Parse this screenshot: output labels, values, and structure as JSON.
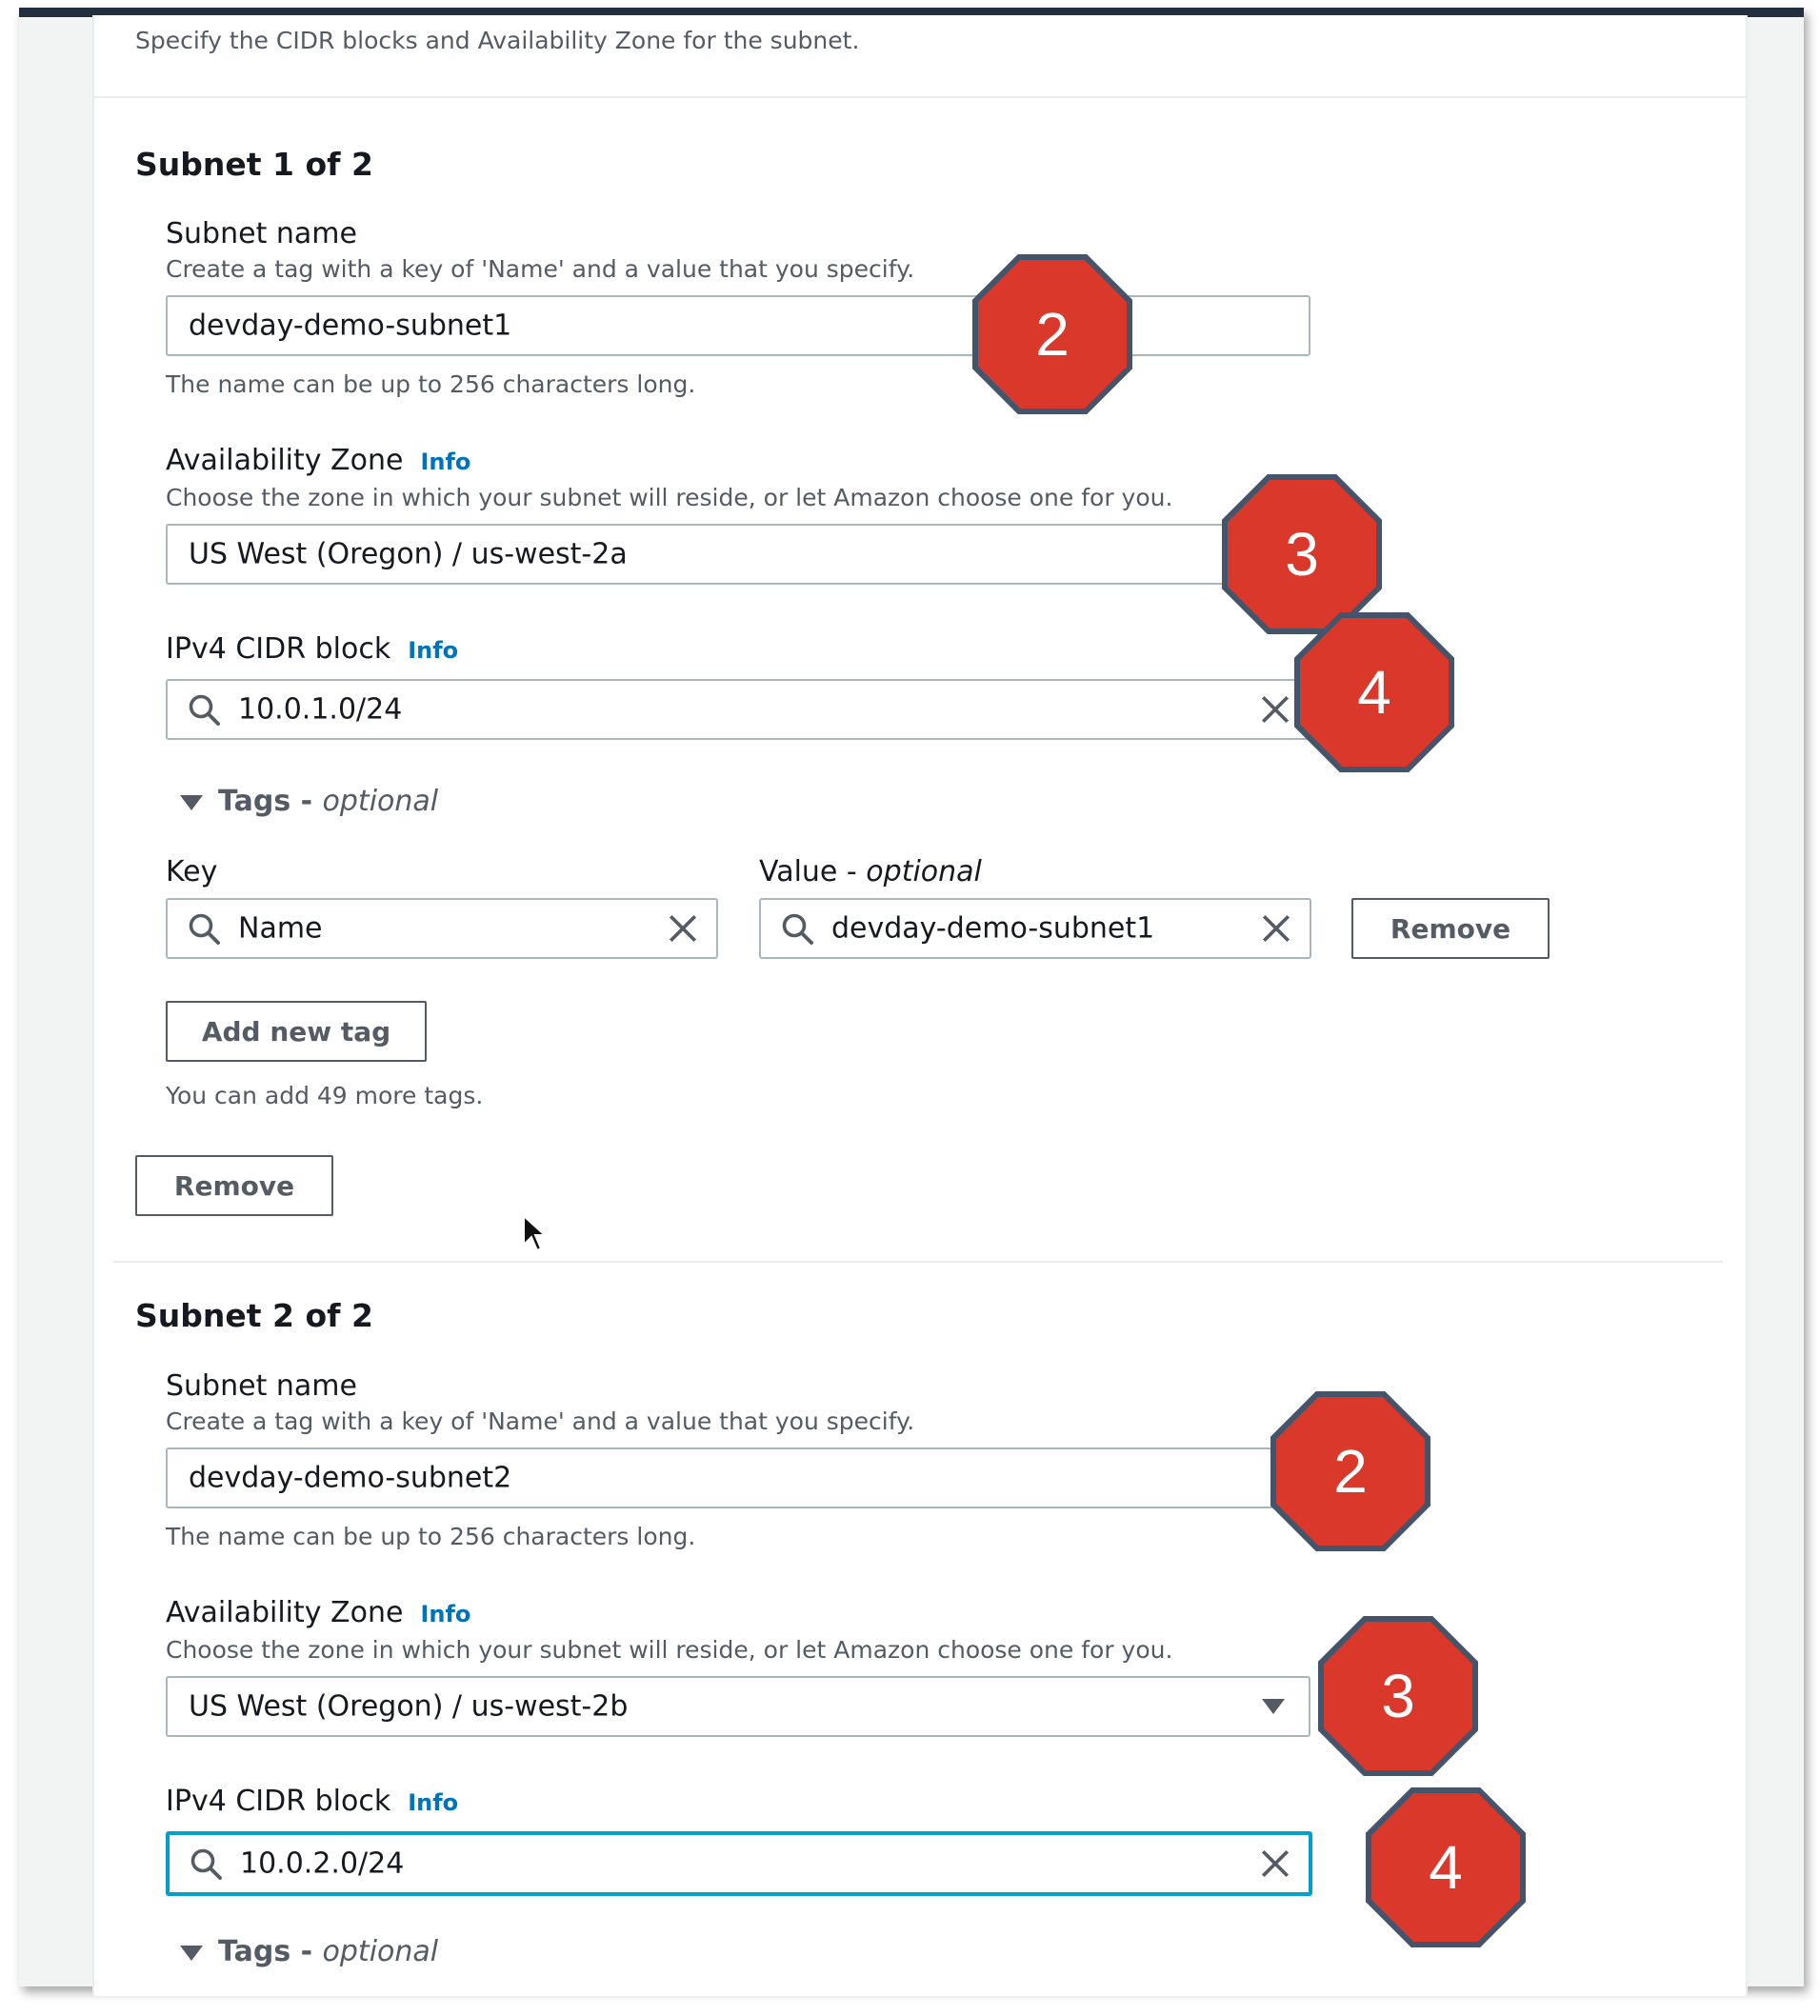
{
  "header": {
    "description": "Specify the CIDR blocks and Availability Zone for the subnet."
  },
  "subnets": [
    {
      "title": "Subnet 1 of 2",
      "name_label": "Subnet name",
      "name_desc": "Create a tag with a key of 'Name' and a value that you specify.",
      "name_value": "devday-demo-subnet1",
      "name_hint": "The name can be up to 256 characters long.",
      "az_label": "Availability Zone",
      "az_info": "Info",
      "az_desc": "Choose the zone in which your subnet will reside, or let Amazon choose one for you.",
      "az_value": "US West (Oregon) / us-west-2a",
      "cidr_label": "IPv4 CIDR block",
      "cidr_info": "Info",
      "cidr_value": "10.0.1.0/24",
      "tags_label": "Tags -",
      "tags_optional": "optional",
      "key_label": "Key",
      "value_label": "Value -",
      "value_optional": "optional",
      "tag_key": "Name",
      "tag_value": "devday-demo-subnet1",
      "tag_remove": "Remove",
      "add_tag": "Add new tag",
      "tags_hint": "You can add 49 more tags.",
      "remove_subnet": "Remove"
    },
    {
      "title": "Subnet 2 of 2",
      "name_label": "Subnet name",
      "name_desc": "Create a tag with a key of 'Name' and a value that you specify.",
      "name_value": "devday-demo-subnet2",
      "name_hint": "The name can be up to 256 characters long.",
      "az_label": "Availability Zone",
      "az_info": "Info",
      "az_desc": "Choose the zone in which your subnet will reside, or let Amazon choose one for you.",
      "az_value": "US West (Oregon) / us-west-2b",
      "cidr_label": "IPv4 CIDR block",
      "cidr_info": "Info",
      "cidr_value": "10.0.2.0/24",
      "tags_label": "Tags -",
      "tags_optional": "optional"
    }
  ],
  "callouts": [
    "2",
    "3",
    "4",
    "2",
    "3",
    "4"
  ],
  "colors": {
    "callout_fill": "#d9382b",
    "callout_border": "#44546a",
    "link": "#0073bb",
    "focus": "#00a1c9"
  }
}
